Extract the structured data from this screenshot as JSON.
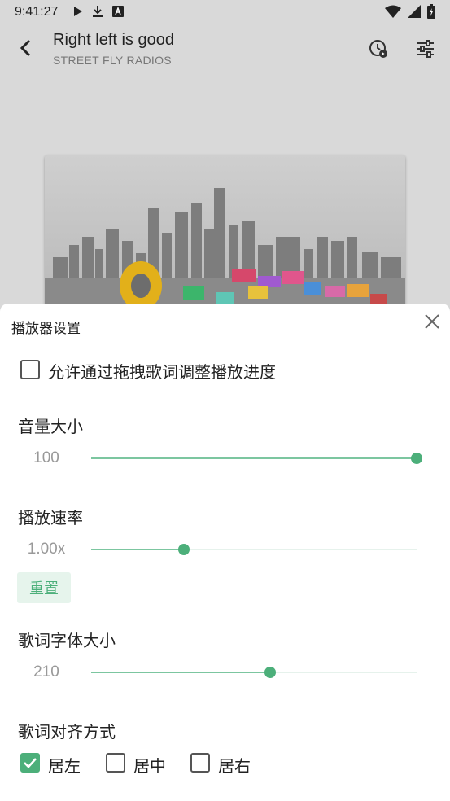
{
  "status_bar": {
    "time": "9:41:27",
    "left_icons": [
      "play-icon",
      "download-icon",
      "font-a-icon"
    ],
    "right_icons": [
      "wifi-icon",
      "cell-signal-icon",
      "battery-icon"
    ]
  },
  "app_bar": {
    "title": "Right left is good",
    "subtitle": "STREET FLY RADIOS"
  },
  "sheet": {
    "title": "播放器设置",
    "drag_seek": {
      "label": "允许通过拖拽歌词调整播放进度",
      "checked": false
    },
    "volume": {
      "label": "音量大小",
      "value": "100",
      "fraction": 1.0
    },
    "speed": {
      "label": "播放速率",
      "value": "1.00x",
      "fraction": 0.285,
      "reset_label": "重置"
    },
    "font_size": {
      "label": "歌词字体大小",
      "value": "210",
      "fraction": 0.55
    },
    "alignment": {
      "label": "歌词对齐方式",
      "options": [
        {
          "label": "居左",
          "checked": true
        },
        {
          "label": "居中",
          "checked": false
        },
        {
          "label": "居右",
          "checked": false
        }
      ]
    }
  },
  "colors": {
    "accent": "#4caf7a",
    "accent_light": "#7cc6a0",
    "track": "#e6f2ec",
    "reset_bg": "#e6f4ec"
  }
}
